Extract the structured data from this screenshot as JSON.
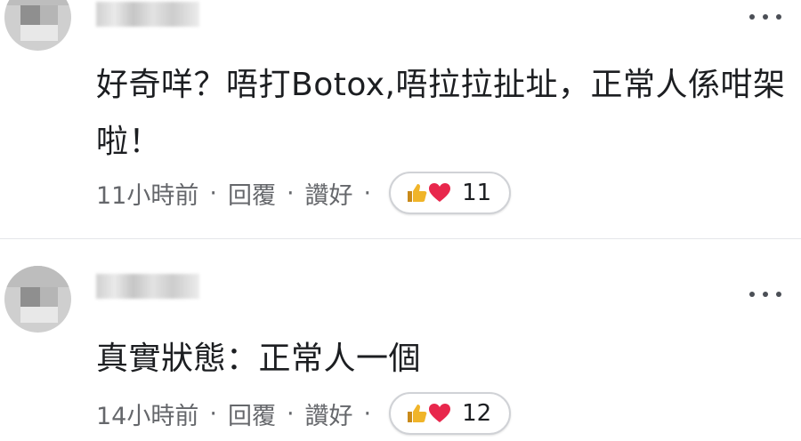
{
  "comments": [
    {
      "text": "好奇咩？唔打Botox,唔拉拉扯址，正常人係咁架啦！",
      "time": "11小時前",
      "reply": "回覆",
      "like": "讚好",
      "separator": "·",
      "reaction_count": "11"
    },
    {
      "text": "真實狀態：正常人一個",
      "time": "14小時前",
      "reply": "回覆",
      "like": "讚好",
      "separator": "·",
      "reaction_count": "12"
    }
  ],
  "icons": {
    "more": "more-options-icon",
    "like": "thumbs-up-icon",
    "love": "heart-icon"
  },
  "colors": {
    "meta_text": "#65676b",
    "like_reaction": "#f0b429",
    "love_reaction": "#e8274c"
  }
}
